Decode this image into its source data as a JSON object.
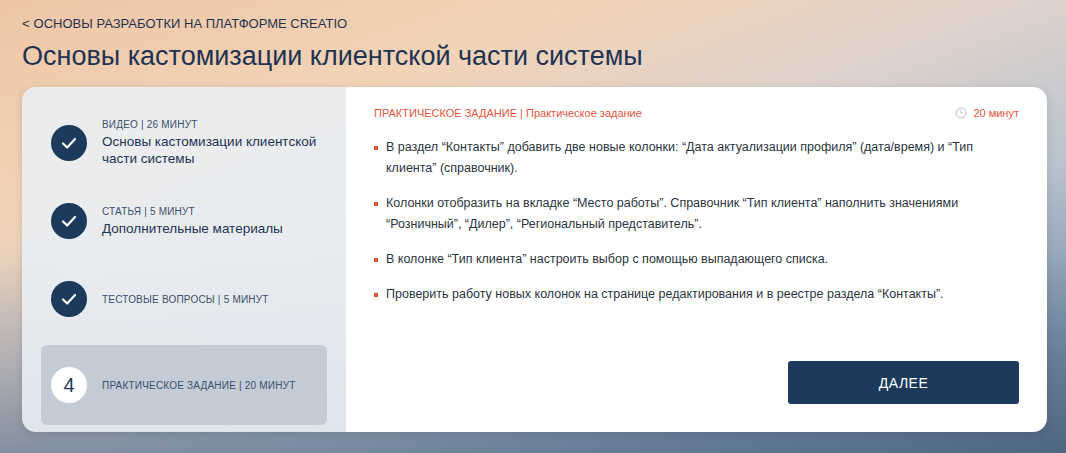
{
  "breadcrumb": {
    "icon": "<",
    "label": "ОСНОВЫ РАЗРАБОТКИ НА ПЛАТФОРМЕ CREATIO"
  },
  "title": "Основы кастомизации клиентской части системы",
  "steps": [
    {
      "meta": "ВИДЕО | 26 МИНУТ",
      "title": "Основы кастомизации клиентской части системы",
      "completed": true,
      "selected": false
    },
    {
      "meta": "СТАТЬЯ | 5 МИНУТ",
      "title": "Дополнительные материалы",
      "completed": true,
      "selected": false
    },
    {
      "meta": "ТЕСТОВЫЕ ВОПРОСЫ | 5 МИНУТ",
      "completed": true,
      "selected": false
    },
    {
      "meta": "ПРАКТИЧЕСКОЕ ЗАДАНИЕ | 20 МИНУТ",
      "number": "4",
      "completed": false,
      "selected": true
    }
  ],
  "task": {
    "kind_label": "ПРАКТИЧЕСКОЕ ЗАДАНИЕ | Практическое задание",
    "duration": "20 минут",
    "items": [
      "В раздел “Контакты” добавить две новые колонки: “Дата актуализации профиля” (дата/время) и “Тип клиента” (справочник).",
      "Колонки отобразить на вкладке “Место работы”. Справочник “Тип клиента” наполнить значениями “Розничный”, “Дилер”, “Региональный представитель”.",
      "В колонке “Тип клиента” настроить выбор с помощью выпадающего списка.",
      "Проверить работу новых колонок на странице редактирования и в реестре раздела “Контакты”."
    ],
    "button": "ДАЛЕЕ"
  }
}
